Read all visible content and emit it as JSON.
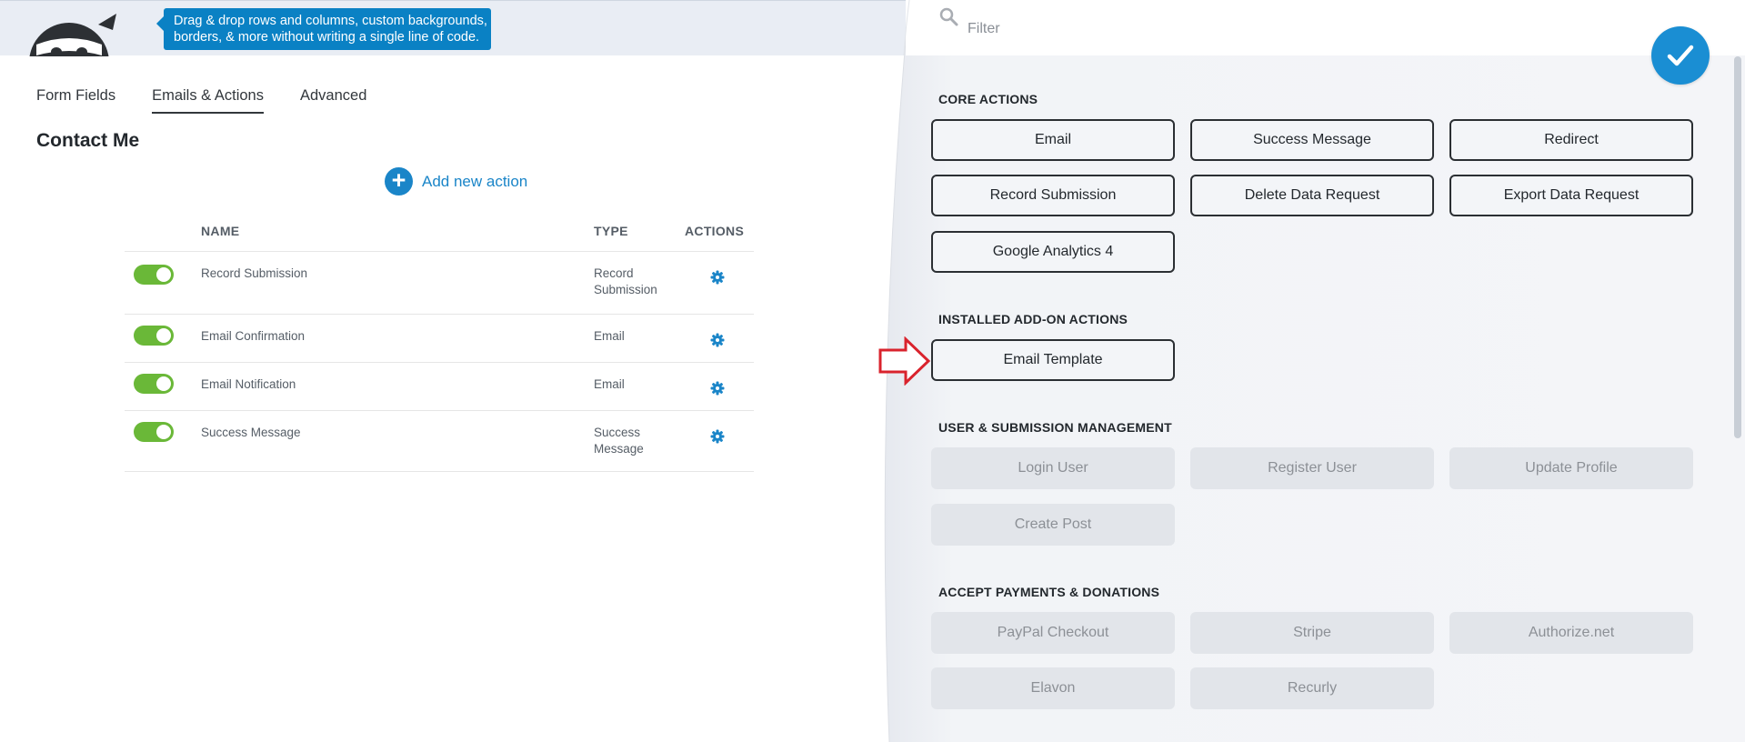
{
  "header": {
    "tip_line1": "Drag & drop rows and columns, custom backgrounds,",
    "tip_line2": "borders, & more without writing a single line of code."
  },
  "tabs": [
    {
      "label": "Form Fields",
      "active": false
    },
    {
      "label": "Emails & Actions",
      "active": true
    },
    {
      "label": "Advanced",
      "active": false
    }
  ],
  "form_title": "Contact Me",
  "add_action_label": "Add new action",
  "table": {
    "headers": {
      "name": "NAME",
      "type": "TYPE",
      "actions": "ACTIONS"
    },
    "rows": [
      {
        "name": "Record Submission",
        "type": "Record Submission",
        "enabled": true
      },
      {
        "name": "Email Confirmation",
        "type": "Email",
        "enabled": true
      },
      {
        "name": "Email Notification",
        "type": "Email",
        "enabled": true
      },
      {
        "name": "Success Message",
        "type": "Success Message",
        "enabled": true
      }
    ]
  },
  "drawer": {
    "filter_placeholder": "Filter",
    "sections": {
      "core": "CORE ACTIONS",
      "installed": "INSTALLED ADD-ON ACTIONS",
      "user": "USER & SUBMISSION MANAGEMENT",
      "payments": "ACCEPT PAYMENTS & DONATIONS"
    },
    "core_actions": [
      "Email",
      "Success Message",
      "Redirect",
      "Record Submission",
      "Delete Data Request",
      "Export Data Request",
      "Google Analytics 4"
    ],
    "installed_actions": [
      "Email Template"
    ],
    "user_actions": [
      "Login User",
      "Register User",
      "Update Profile",
      "Create Post"
    ],
    "payment_actions": [
      "PayPal Checkout",
      "Stripe",
      "Authorize.net",
      "Elavon",
      "Recurly"
    ]
  },
  "colors": {
    "accent": "#1a85c8",
    "toggle_on": "#6ab838",
    "arrow": "#d9232d"
  }
}
